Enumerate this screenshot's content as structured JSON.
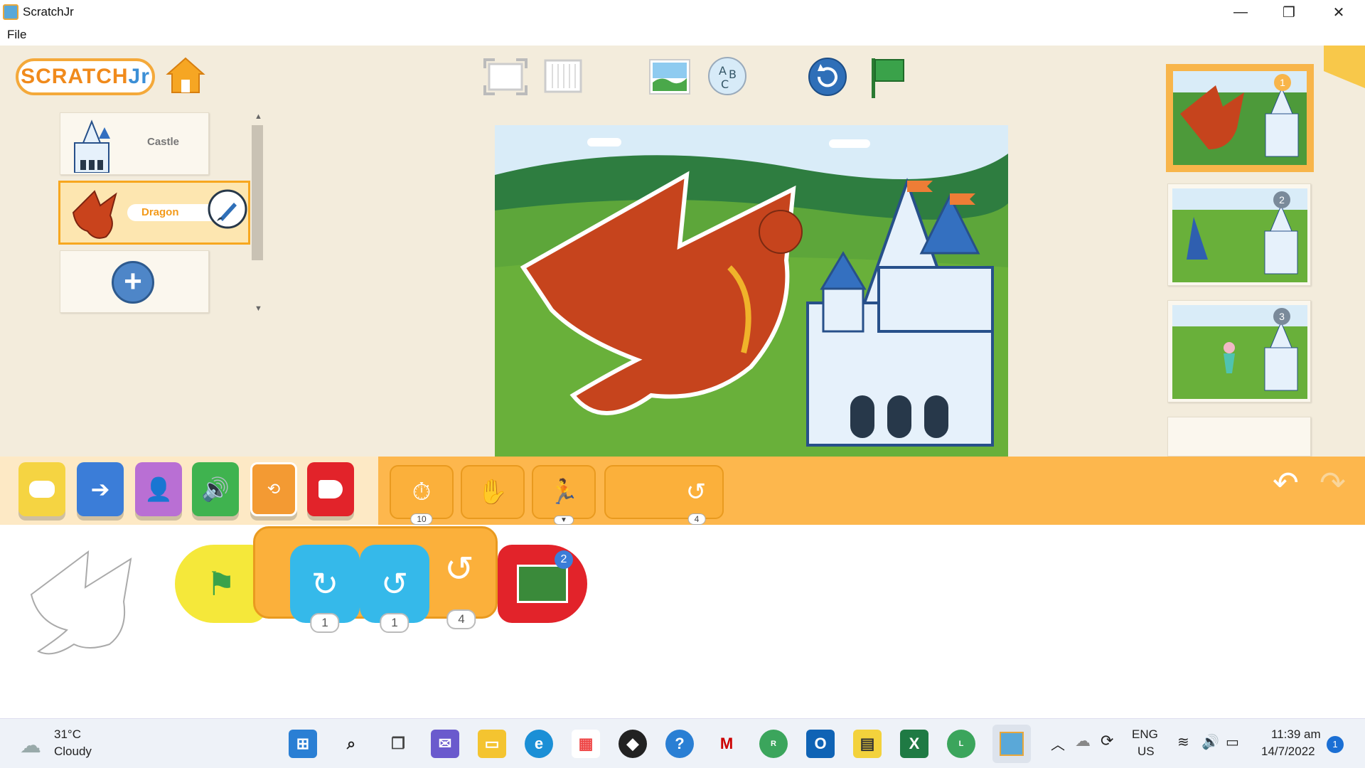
{
  "window": {
    "title": "ScratchJr",
    "minimize": "—",
    "restore": "❐",
    "close": "✕"
  },
  "menu": {
    "file": "File"
  },
  "toolbar": {
    "logo_scratch": "SCRATCH",
    "logo_jr": "Jr",
    "icons": [
      "home-icon",
      "fullscreen-icon",
      "grid-icon",
      "background-icon",
      "text-icon",
      "reset-icon",
      "green-flag-icon"
    ]
  },
  "sprites": {
    "items": [
      {
        "label": "Castle"
      },
      {
        "label": "Dragon",
        "selected": true
      }
    ],
    "add": "+"
  },
  "pages": [
    {
      "number": "1"
    },
    {
      "number": "2"
    },
    {
      "number": "3"
    }
  ],
  "categories": [
    {
      "name": "triggering-category",
      "color": "#f5d442"
    },
    {
      "name": "motion-category",
      "color": "#3b7dd8"
    },
    {
      "name": "looks-category",
      "color": "#b96fd4"
    },
    {
      "name": "sound-category",
      "color": "#3fb34f"
    },
    {
      "name": "control-category",
      "color": "#f39a33"
    },
    {
      "name": "end-category",
      "color": "#e2232a"
    }
  ],
  "palette_blocks": [
    {
      "name": "wait-block",
      "num": "10"
    },
    {
      "name": "stop-block",
      "num": ""
    },
    {
      "name": "set-speed-block",
      "num": ""
    },
    {
      "name": "repeat-block",
      "num": "4"
    }
  ],
  "script_blocks": [
    {
      "name": "green-flag-trigger",
      "num": ""
    },
    {
      "name": "turn-right-block",
      "num": "1"
    },
    {
      "name": "turn-left-block",
      "num": "1"
    },
    {
      "name": "repeat-loop-block",
      "num": "4"
    },
    {
      "name": "go-to-page-block",
      "num": "2"
    }
  ],
  "taskbar": {
    "weather_temp": "31°C",
    "weather_desc": "Cloudy",
    "lang_top": "ENG",
    "lang_bottom": "US",
    "time": "11:39 am",
    "date": "14/7/2022",
    "notif": "1",
    "chrome_badge_1": "R",
    "chrome_badge_2": "L"
  }
}
